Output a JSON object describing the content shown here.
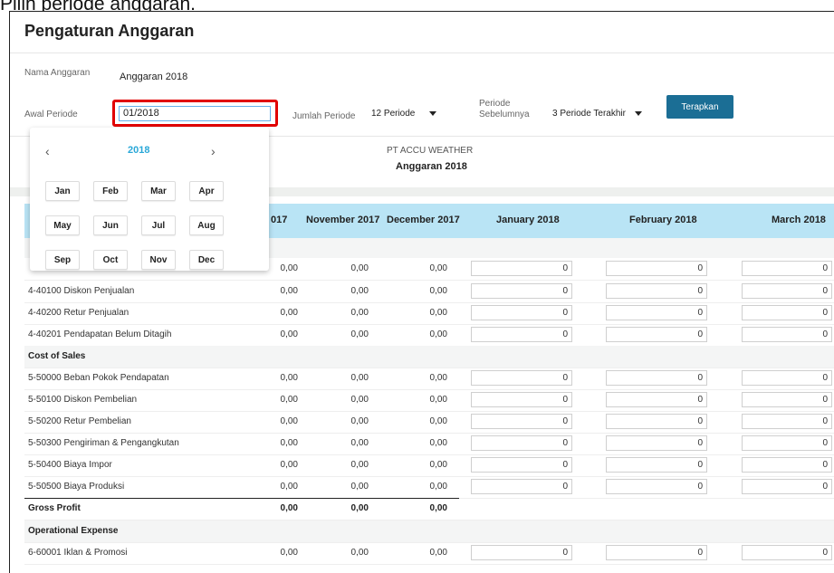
{
  "caption": "Pilih periode anggaran.",
  "page_title": "Pengaturan Anggaran",
  "form": {
    "budget_name_label": "Nama Anggaran",
    "budget_name_value": "Anggaran 2018",
    "start_period_label": "Awal Periode",
    "start_period_value": "01/2018",
    "period_count_label": "Jumlah Periode",
    "period_count_value": "12 Periode",
    "previous_period_label_1": "Periode",
    "previous_period_label_2": "Sebelumnya",
    "previous_period_value": "3 Periode Terakhir",
    "apply_label": "Terapkan"
  },
  "report": {
    "company": "PT ACCU WEATHER",
    "budget": "Anggaran 2018"
  },
  "calendar": {
    "prev": "‹",
    "next": "›",
    "year": "2018",
    "months": [
      "Jan",
      "Feb",
      "Mar",
      "Apr",
      "May",
      "Jun",
      "Jul",
      "Aug",
      "Sep",
      "Oct",
      "Nov",
      "Dec"
    ]
  },
  "table": {
    "headers": [
      "017",
      "November 2017",
      "December 2017",
      "January 2018",
      "February 2018",
      "March 2018"
    ],
    "rows": [
      {
        "kind": "data",
        "account": "",
        "values": [
          "0,00",
          "0,00",
          "0,00"
        ],
        "inputs": [
          "0",
          "0",
          "0"
        ]
      },
      {
        "kind": "data",
        "account": "4-40100 Diskon Penjualan",
        "values": [
          "0,00",
          "0,00",
          "0,00"
        ],
        "inputs": [
          "0",
          "0",
          "0"
        ]
      },
      {
        "kind": "data",
        "account": "4-40200 Retur Penjualan",
        "values": [
          "0,00",
          "0,00",
          "0,00"
        ],
        "inputs": [
          "0",
          "0",
          "0"
        ]
      },
      {
        "kind": "data",
        "account": "4-40201 Pendapatan Belum Ditagih",
        "values": [
          "0,00",
          "0,00",
          "0,00"
        ],
        "inputs": [
          "0",
          "0",
          "0"
        ]
      },
      {
        "kind": "section",
        "account": "Cost of Sales"
      },
      {
        "kind": "data",
        "account": "5-50000 Beban Pokok Pendapatan",
        "values": [
          "0,00",
          "0,00",
          "0,00"
        ],
        "inputs": [
          "0",
          "0",
          "0"
        ]
      },
      {
        "kind": "data",
        "account": "5-50100 Diskon Pembelian",
        "values": [
          "0,00",
          "0,00",
          "0,00"
        ],
        "inputs": [
          "0",
          "0",
          "0"
        ]
      },
      {
        "kind": "data",
        "account": "5-50200 Retur Pembelian",
        "values": [
          "0,00",
          "0,00",
          "0,00"
        ],
        "inputs": [
          "0",
          "0",
          "0"
        ]
      },
      {
        "kind": "data",
        "account": "5-50300 Pengiriman & Pengangkutan",
        "values": [
          "0,00",
          "0,00",
          "0,00"
        ],
        "inputs": [
          "0",
          "0",
          "0"
        ]
      },
      {
        "kind": "data",
        "account": "5-50400 Biaya Impor",
        "values": [
          "0,00",
          "0,00",
          "0,00"
        ],
        "inputs": [
          "0",
          "0",
          "0"
        ]
      },
      {
        "kind": "data",
        "account": "5-50500 Biaya Produksi",
        "values": [
          "0,00",
          "0,00",
          "0,00"
        ],
        "inputs": [
          "0",
          "0",
          "0"
        ]
      },
      {
        "kind": "total",
        "account": "Gross Profit",
        "values": [
          "0,00",
          "0,00",
          "0,00"
        ]
      },
      {
        "kind": "section",
        "account": "Operational Expense"
      },
      {
        "kind": "data",
        "account": "6-60001 Iklan & Promosi",
        "values": [
          "0,00",
          "0,00",
          "0,00"
        ],
        "inputs": [
          "0",
          "0",
          "0"
        ]
      }
    ]
  }
}
